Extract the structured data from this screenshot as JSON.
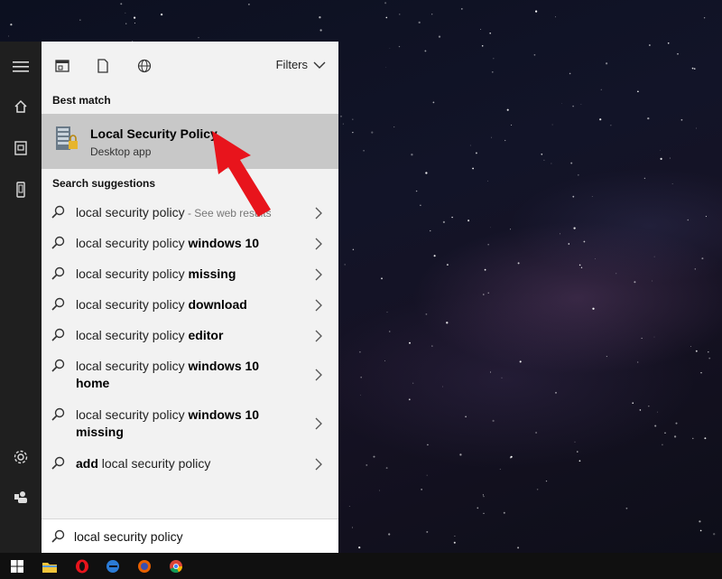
{
  "rail": {
    "items": [
      "hamburger-icon",
      "home-icon",
      "documents-icon",
      "device-icon",
      "settings-icon",
      "user-icon"
    ]
  },
  "toolbar": {
    "icons": [
      "apps-filter-icon",
      "documents-filter-icon",
      "web-filter-icon"
    ],
    "filters_label": "Filters"
  },
  "best_match": {
    "section_label": "Best match",
    "title": "Local Security Policy",
    "subtitle": "Desktop app"
  },
  "suggestions": {
    "section_label": "Search suggestions",
    "items": [
      {
        "plain": "local security policy",
        "hint": " - See web results",
        "bold_after": "",
        "bold_before": "",
        "second_line": ""
      },
      {
        "plain": "local security policy ",
        "hint": "",
        "bold_after": "windows 10",
        "bold_before": "",
        "second_line": ""
      },
      {
        "plain": "local security policy ",
        "hint": "",
        "bold_after": "missing",
        "bold_before": "",
        "second_line": ""
      },
      {
        "plain": "local security policy ",
        "hint": "",
        "bold_after": "download",
        "bold_before": "",
        "second_line": ""
      },
      {
        "plain": "local security policy ",
        "hint": "",
        "bold_after": "editor",
        "bold_before": "",
        "second_line": ""
      },
      {
        "plain": "local security policy ",
        "hint": "",
        "bold_after": "windows 10",
        "bold_before": "",
        "second_line": "home"
      },
      {
        "plain": "local security policy ",
        "hint": "",
        "bold_after": "windows 10",
        "bold_before": "",
        "second_line": "missing"
      },
      {
        "plain": " local security policy",
        "hint": "",
        "bold_after": "",
        "bold_before": "add",
        "second_line": ""
      }
    ]
  },
  "search": {
    "value": "local security policy"
  },
  "taskbar": {
    "items": [
      "windows-start-icon",
      "file-explorer-icon",
      "opera-icon",
      "edge-icon",
      "firefox-icon",
      "chrome-icon"
    ]
  },
  "colors": {
    "panel_bg": "#f2f2f2",
    "highlight": "#c8c8c8",
    "rail_bg": "#1f1f1f",
    "arrow": "#e8141c"
  }
}
